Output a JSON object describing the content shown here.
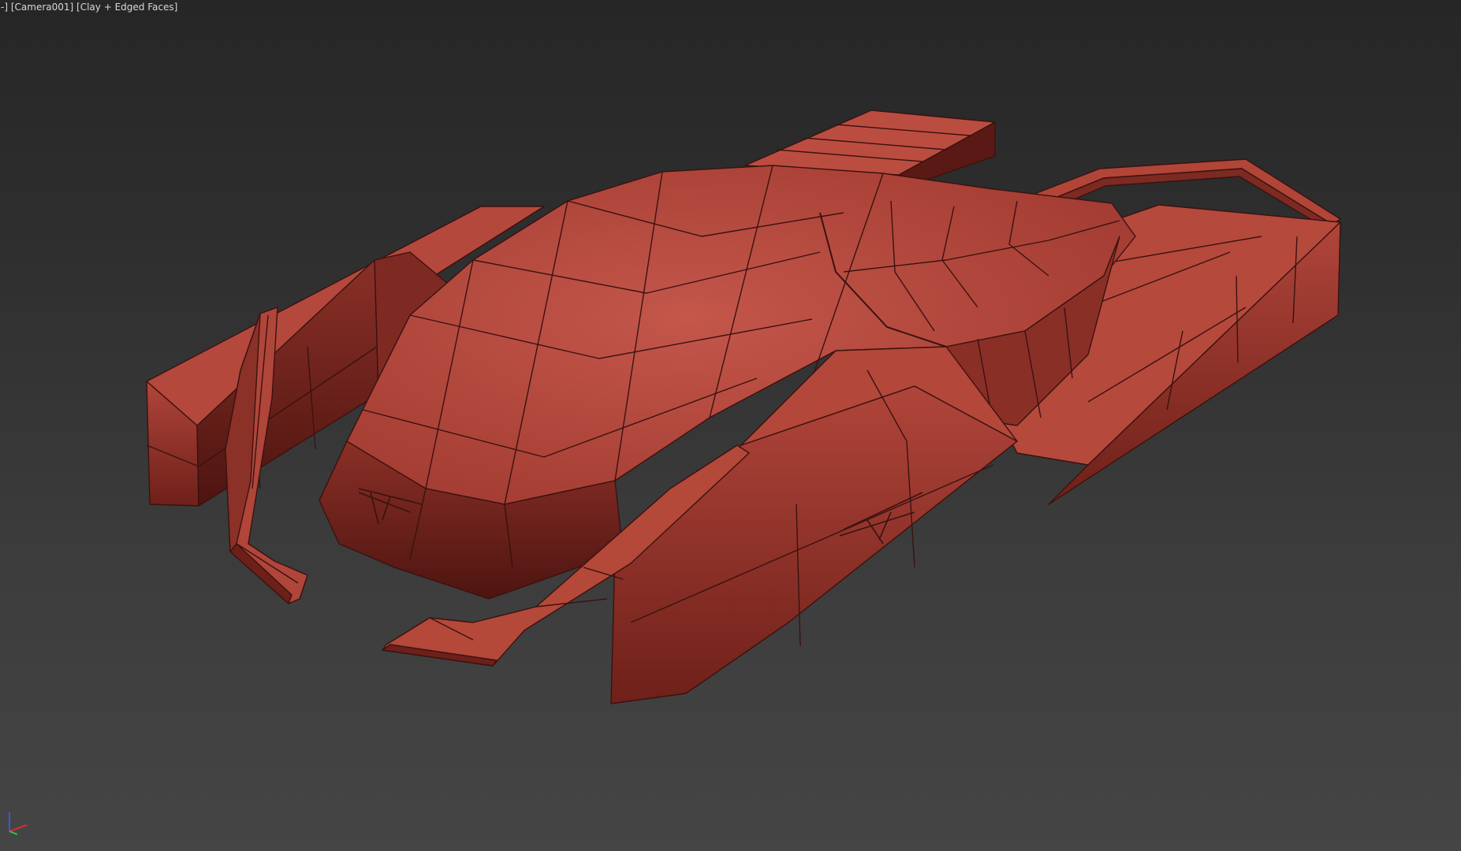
{
  "viewport": {
    "menu_label": "-",
    "camera_label": "Camera001",
    "shading_label": "Clay + Edged Faces"
  },
  "model": {
    "name": "hover-vehicle",
    "face_color": "#b4493c",
    "edge_color": "#3a1210"
  },
  "axis_gizmo": {
    "x_color": "#c8342b",
    "y_color": "#3bbf3b",
    "z_color": "#3a5bd8"
  }
}
